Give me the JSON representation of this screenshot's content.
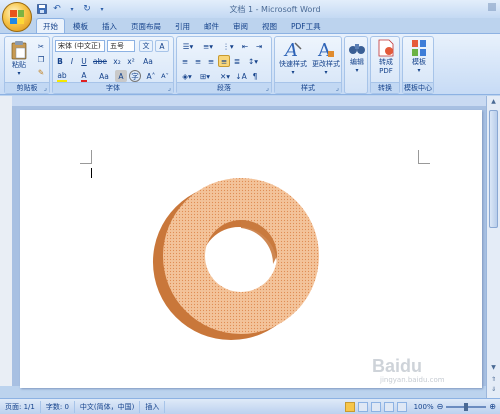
{
  "window": {
    "title": "文档 1 - Microsoft Word"
  },
  "tabs": [
    "开始",
    "插入",
    "页面布局",
    "引用",
    "邮件",
    "审阅",
    "视图",
    "PDF工具"
  ],
  "tab_extra": "模板",
  "ribbon": {
    "clipboard": {
      "paste_label": "粘贴",
      "group_label": "剪贴板"
    },
    "font": {
      "font_name": "宋体 (中文正)",
      "font_size": "五号",
      "group_label": "字体",
      "font_color": "#e02020",
      "highlight_color": "#f5e800"
    },
    "paragraph": {
      "group_label": "段落"
    },
    "styles": {
      "quick_styles_label": "快速样式",
      "change_styles_label": "更改样式",
      "group_label": "样式"
    },
    "editing": {
      "edit_label": "编辑"
    },
    "convert": {
      "to_pdf_label1": "转成",
      "to_pdf_label2": "PDF",
      "group_label": "转换"
    },
    "template": {
      "template_label": "模板",
      "group_label": "模板中心"
    }
  },
  "statusbar": {
    "page": "页面: 1/1",
    "words": "字数: 0",
    "language": "中文(简体，中国)",
    "mode": "插入",
    "zoom": "100%"
  },
  "document": {
    "shape_colors": {
      "light": "#f3c39a",
      "dark": "#c9773a",
      "dots": "#e08c52"
    }
  },
  "watermark": {
    "site": "Baidu",
    "sub": "jingyan.baidu.com"
  }
}
